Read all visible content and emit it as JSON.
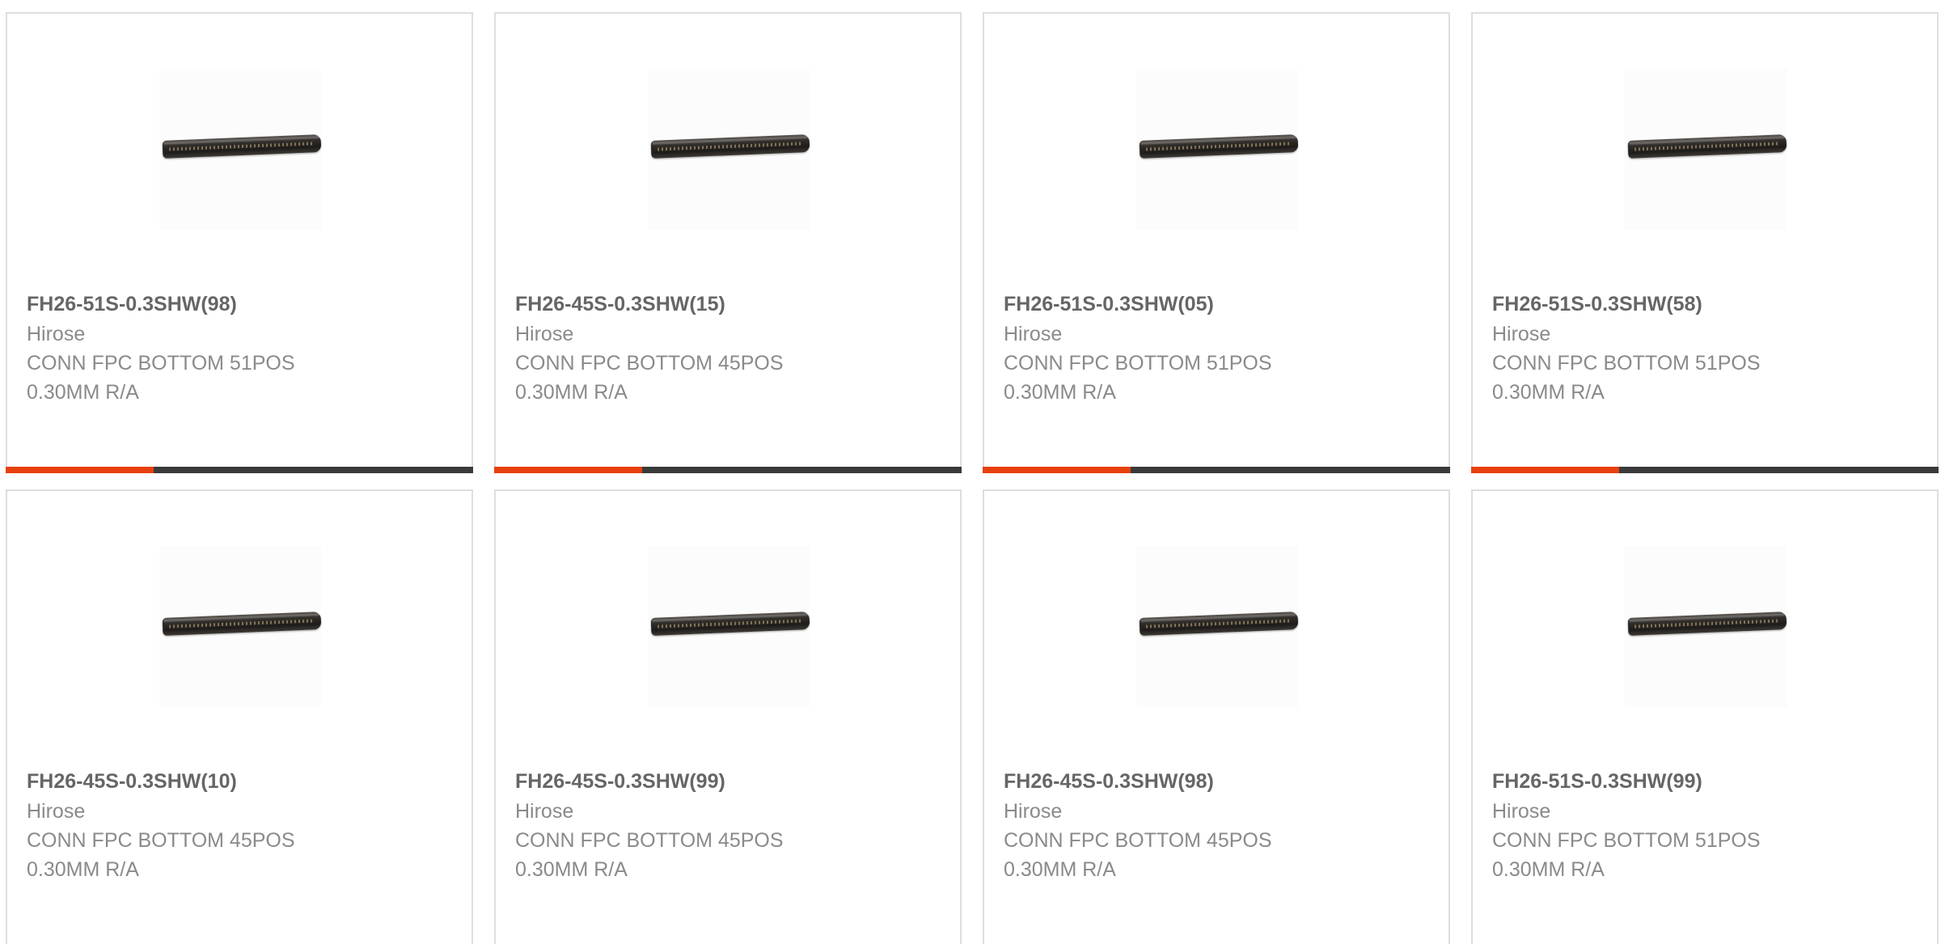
{
  "accent_color": "#e8400f",
  "bar_color": "#3a3a3a",
  "products": [
    {
      "part": "FH26-51S-0.3SHW(98)",
      "manufacturer": "Hirose",
      "description": "CONN FPC BOTTOM 51POS 0.30MM R/A",
      "image": "fpc-connector-image"
    },
    {
      "part": "FH26-45S-0.3SHW(15)",
      "manufacturer": "Hirose",
      "description": "CONN FPC BOTTOM 45POS 0.30MM R/A",
      "image": "fpc-connector-image"
    },
    {
      "part": "FH26-51S-0.3SHW(05)",
      "manufacturer": "Hirose",
      "description": "CONN FPC BOTTOM 51POS 0.30MM R/A",
      "image": "fpc-connector-image"
    },
    {
      "part": "FH26-51S-0.3SHW(58)",
      "manufacturer": "Hirose",
      "description": "CONN FPC BOTTOM 51POS 0.30MM R/A",
      "image": "fpc-connector-image"
    },
    {
      "part": "FH26-45S-0.3SHW(10)",
      "manufacturer": "Hirose",
      "description": "CONN FPC BOTTOM 45POS 0.30MM R/A",
      "image": "fpc-connector-image"
    },
    {
      "part": "FH26-45S-0.3SHW(99)",
      "manufacturer": "Hirose",
      "description": "CONN FPC BOTTOM 45POS 0.30MM R/A",
      "image": "fpc-connector-image"
    },
    {
      "part": "FH26-45S-0.3SHW(98)",
      "manufacturer": "Hirose",
      "description": "CONN FPC BOTTOM 45POS 0.30MM R/A",
      "image": "fpc-connector-image"
    },
    {
      "part": "FH26-51S-0.3SHW(99)",
      "manufacturer": "Hirose",
      "description": "CONN FPC BOTTOM 51POS 0.30MM R/A",
      "image": "fpc-connector-image"
    }
  ]
}
